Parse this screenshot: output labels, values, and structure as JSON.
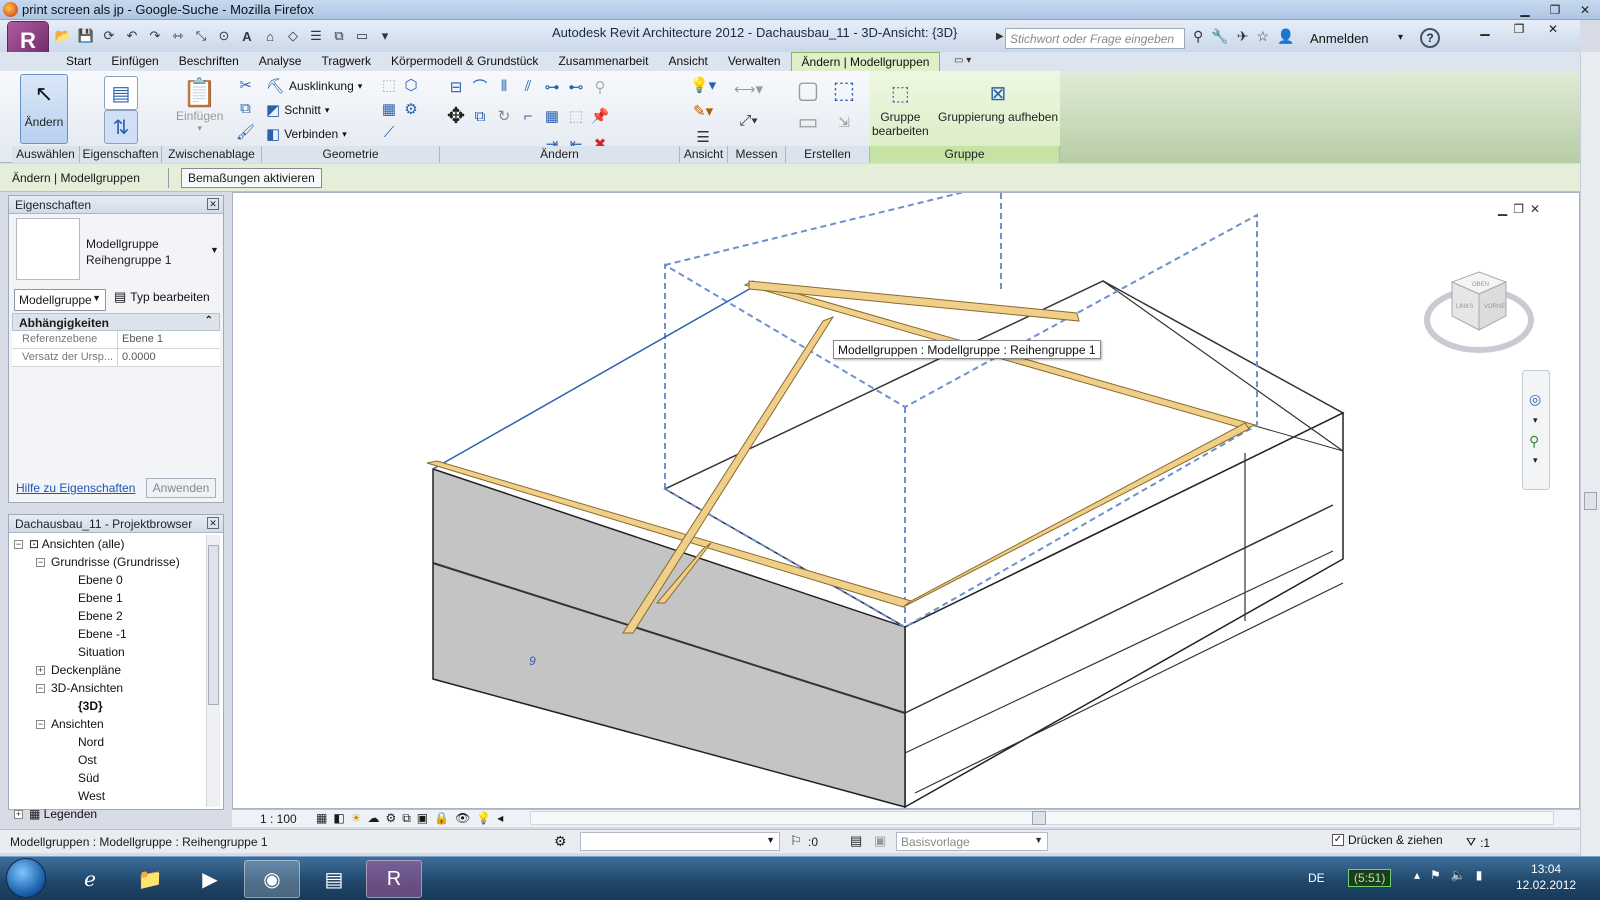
{
  "firefox": {
    "title": "print screen als jp - Google-Suche - Mozilla Firefox"
  },
  "revit": {
    "app_title": "Autodesk Revit Architecture 2012 -",
    "doc_title": "Dachausbau_11 - 3D-Ansicht: {3D}",
    "search_placeholder": "Stichwort oder Frage eingeben",
    "signin": "Anmelden",
    "help": "?"
  },
  "tabs": [
    "Start",
    "Einfügen",
    "Beschriften",
    "Analyse",
    "Tragwerk",
    "Körpermodell & Grundstück",
    "Zusammenarbeit",
    "Ansicht",
    "Verwalten",
    "Ändern | Modellgruppen"
  ],
  "ribbon": {
    "aendern": "Ändern",
    "einfuegen": "Einfügen",
    "ausklinkung": "Ausklinkung",
    "schnitt": "Schnitt",
    "verbinden": "Verbinden",
    "gruppe_bearbeiten_1": "Gruppe",
    "gruppe_bearbeiten_2": "bearbeiten",
    "gruppierung_aufheben": "Gruppierung aufheben",
    "panels": [
      "Auswählen",
      "Eigenschaften",
      "Zwischenablage",
      "Geometrie",
      "Ändern",
      "Ansicht",
      "Messen",
      "Erstellen",
      "Gruppe"
    ]
  },
  "options_bar": {
    "context": "Ändern | Modellgruppen",
    "button": "Bemaßungen aktivieren"
  },
  "properties": {
    "title": "Eigenschaften",
    "type_line1": "Modellgruppe",
    "type_line2": "Reihengruppe 1",
    "selector": "Modellgruppe",
    "edit_type": "Typ bearbeiten",
    "group": "Abhängigkeiten",
    "rows": [
      {
        "key": "Referenzebene",
        "value": "Ebene 1"
      },
      {
        "key": "Versatz der Ursp...",
        "value": "0.0000"
      }
    ],
    "help_link": "Hilfe zu Eigenschaften",
    "apply": "Anwenden"
  },
  "browser": {
    "title": "Dachausbau_11 - Projektbrowser",
    "items": [
      "Ansichten (alle)",
      "Grundrisse (Grundrisse)",
      "Ebene 0",
      "Ebene 1",
      "Ebene 2",
      "Ebene -1",
      "Situation",
      "Deckenpläne",
      "3D-Ansichten",
      "{3D}",
      "Ansichten",
      "Nord",
      "Ost",
      "Süd",
      "West",
      "Legenden"
    ]
  },
  "viewport": {
    "tooltip": "Modellgruppen : Modellgruppe : Reihengruppe 1",
    "level_mark": "9",
    "viewcube": [
      "OBEN",
      "LINKS",
      "VORNE"
    ]
  },
  "view_control": {
    "scale": "1 : 100"
  },
  "status": {
    "text": "Modellgruppen : Modellgruppe : Reihengruppe 1",
    "num": ":0",
    "template": "Basisvorlage",
    "druecken": "Drücken & ziehen",
    "filter": ":1"
  },
  "taskbar": {
    "lang": "DE",
    "battery": "(5:51)",
    "time": "13:04",
    "date": "12.02.2012"
  },
  "colors": {
    "ribbon_ctx": "#dff0c8",
    "wood": "#f0cf8a",
    "dash": "#6d8fd0",
    "wall_gray": "#c4c4c4"
  }
}
